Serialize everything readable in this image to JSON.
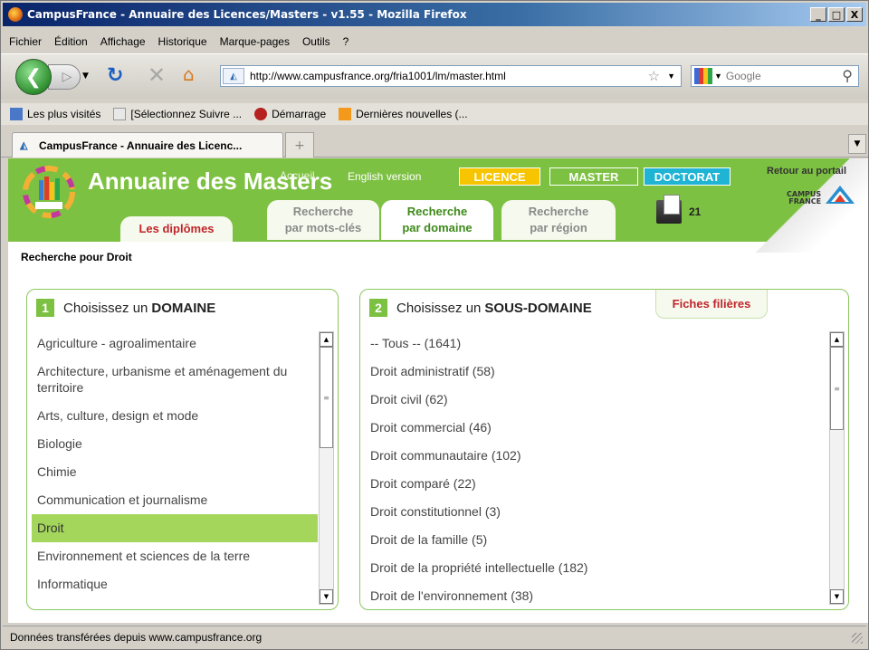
{
  "window": {
    "title": "CampusFrance - Annuaire des Licences/Masters - v1.55 - Mozilla Firefox",
    "buttons": [
      "_",
      "□",
      "X"
    ]
  },
  "menu": [
    "Fichier",
    "Édition",
    "Affichage",
    "Historique",
    "Marque-pages",
    "Outils",
    "?"
  ],
  "toolbar": {
    "url": "http://www.campusfrance.org/fria1001/lm/master.html",
    "search_placeholder": "Google"
  },
  "bookmarks": [
    "Les plus visités",
    "[Sélectionnez Suivre ...",
    "Démarrage",
    "Dernières nouvelles (..."
  ],
  "tab": {
    "label": "CampusFrance - Annuaire des Licenc...",
    "new_tab": "+"
  },
  "header": {
    "site_title": "Annuaire des Masters",
    "accueil": "Accueil",
    "english": "English version",
    "licence": "LICENCE",
    "master": "MASTER",
    "doctorat": "DOCTORAT",
    "retour": "Retour au portail",
    "selection_count": "21",
    "cf_logo_1": "CAMPUS",
    "cf_logo_2": "FRANCE"
  },
  "nav_tabs": {
    "diplomes": "Les diplômes",
    "mots_1": "Recherche",
    "mots_2": "par mots-clés",
    "domaine_1": "Recherche",
    "domaine_2": "par domaine",
    "region_1": "Recherche",
    "region_2": "par région"
  },
  "search_label": "Recherche pour Droit",
  "domain_box": {
    "number": "1",
    "title_prefix": "Choisissez un",
    "title_bold": "DOMAINE",
    "items": [
      "Agriculture - agroalimentaire",
      "Architecture, urbanisme et aménagement du territoire",
      "Arts, culture, design et mode",
      "Biologie",
      "Chimie",
      "Communication et journalisme",
      "Droit",
      "Environnement et sciences de la terre",
      "Informatique"
    ],
    "selected": "Droit"
  },
  "subdomain_box": {
    "number": "2",
    "title_prefix": "Choisissez un",
    "title_bold": "SOUS-DOMAINE",
    "fiches": "Fiches filières",
    "items": [
      "-- Tous -- (1641)",
      "Droit administratif (58)",
      "Droit civil (62)",
      "Droit commercial (46)",
      "Droit communautaire (102)",
      "Droit comparé (22)",
      "Droit constitutionnel (3)",
      "Droit de la famille (5)",
      "Droit de la propriété intellectuelle (182)",
      "Droit de l'environnement (38)"
    ]
  },
  "status": "Données transférées depuis www.campusfrance.org",
  "colors": {
    "header_green": "#7dc142",
    "licence": "#f7c400",
    "doctorat": "#1fb3d4",
    "selected_row": "#a3d65b",
    "accent_red": "#c0252a"
  }
}
